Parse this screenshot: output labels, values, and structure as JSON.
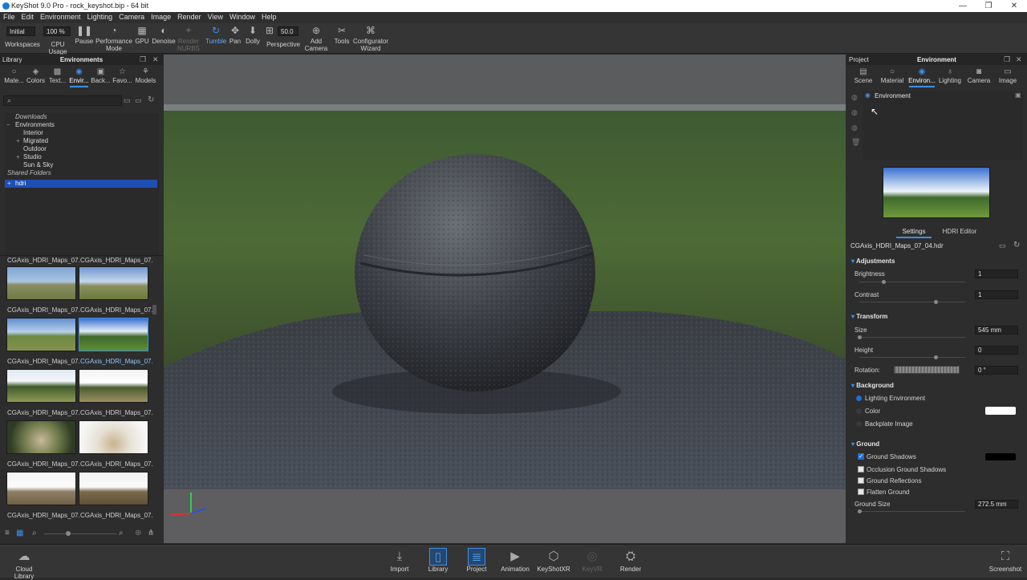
{
  "window": {
    "title": "KeyShot 9.0 Pro  -  rock_keyshot.bip  -  64 bit",
    "minimize": "—",
    "restore": "❐",
    "close": "✕"
  },
  "menu": [
    "File",
    "Edit",
    "Environment",
    "Lighting",
    "Camera",
    "Image",
    "Render",
    "View",
    "Window",
    "Help"
  ],
  "toolbar": {
    "workspace_value": "Initial",
    "workspace_label": "Workspaces",
    "cpu_value": "100 %",
    "cpu_label": "CPU Usage",
    "pause_label": "Pause",
    "performance_label": "Performance Mode",
    "gpu_label": "GPU",
    "denoise_label": "Denoise",
    "render_nurbs_label": "Render NURBS",
    "tumble_label": "Tumble",
    "pan_label": "Pan",
    "dolly_label": "Dolly",
    "fov_value": "50.0",
    "perspective_label": "Perspective",
    "add_camera_label": "Add Camera",
    "tools_label": "Tools",
    "configurator_label": "Configurator Wizard"
  },
  "library": {
    "panel_left": "Library",
    "panel_title": "Environments",
    "tabs": [
      "Mate...",
      "Colors",
      "Text...",
      "Envir...",
      "Back...",
      "Favo...",
      "Models"
    ],
    "tree": [
      {
        "label": "Downloads",
        "style": "italic",
        "indent": 0
      },
      {
        "label": "Environments",
        "style": "normal",
        "indent": 0,
        "prefix": "−"
      },
      {
        "label": "Interior",
        "style": "normal",
        "indent": 1
      },
      {
        "label": "Migrated",
        "style": "normal",
        "indent": 1,
        "prefix": "+"
      },
      {
        "label": "Outdoor",
        "style": "normal",
        "indent": 1
      },
      {
        "label": "Studio",
        "style": "normal",
        "indent": 1,
        "prefix": "+"
      },
      {
        "label": "Sun & Sky",
        "style": "normal",
        "indent": 1
      },
      {
        "label": "Shared Folders",
        "style": "italic",
        "indent": 0
      },
      {
        "label": "hdri",
        "style": "selected",
        "indent": 0,
        "prefix": "+"
      }
    ],
    "thumbnails": [
      "CGAxis_HDRI_Maps_07...",
      "CGAxis_HDRI_Maps_07...",
      "CGAxis_HDRI_Maps_07...",
      "CGAxis_HDRI_Maps_07...",
      "CGAxis_HDRI_Maps_07...",
      "CGAxis_HDRI_Maps_07...",
      "CGAxis_HDRI_Maps_07...",
      "CGAxis_HDRI_Maps_07...",
      "CGAxis_HDRI_Maps_07...",
      "CGAxis_HDRI_Maps_07..."
    ],
    "top_partial": [
      "CGAxis_HDRI_Maps_07...",
      "CGAxis_HDRI_Maps_07..."
    ],
    "selected_thumbnail": 3
  },
  "project": {
    "panel_left": "Project",
    "panel_title": "Environment",
    "tabs": [
      "Scene",
      "Material",
      "Environ...",
      "Lighting",
      "Camera",
      "Image"
    ],
    "env_list_item": "Environment",
    "subtabs": [
      "Settings",
      "HDRI Editor"
    ],
    "hdr_file": "CGAxis_HDRI_Maps_07_04.hdr",
    "adjustments": {
      "title": "Adjustments",
      "brightness_label": "Brightness",
      "brightness": "1",
      "contrast_label": "Contrast",
      "contrast": "1"
    },
    "transform": {
      "title": "Transform",
      "size_label": "Size",
      "size": "545 mm",
      "height_label": "Height",
      "height": "0",
      "rotation_label": "Rotation:",
      "rotation": "0 °"
    },
    "background": {
      "title": "Background",
      "opt1": "Lighting Environment",
      "opt2": "Color",
      "opt3": "Backplate Image",
      "color_swatch": "#ffffff"
    },
    "ground": {
      "title": "Ground",
      "shadows_label": "Ground Shadows",
      "shadow_color": "#000000",
      "occlusion_label": "Occlusion Ground Shadows",
      "reflections_label": "Ground Reflections",
      "flatten_label": "Flatten Ground",
      "size_label": "Ground Size",
      "size": "272.5 mm"
    }
  },
  "bottombar": {
    "cloud_library": "Cloud Library",
    "import": "Import",
    "library": "Library",
    "project": "Project",
    "animation": "Animation",
    "keyshotxr": "KeyShotXR",
    "keyvr": "KeyVR",
    "render": "Render",
    "screenshot": "Screenshot"
  },
  "colors": {
    "accent": "#3d8fe6",
    "selection": "#1f4fb2"
  }
}
